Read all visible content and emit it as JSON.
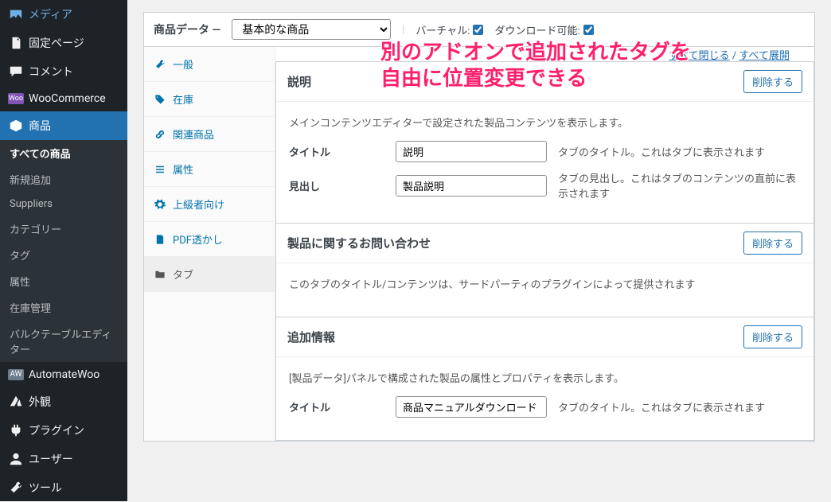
{
  "sidebar": {
    "items": [
      {
        "label": "メディア"
      },
      {
        "label": "固定ページ"
      },
      {
        "label": "コメント"
      },
      {
        "label": "WooCommerce"
      },
      {
        "label": "商品"
      },
      {
        "label": "AutomateWoo"
      },
      {
        "label": "外観"
      },
      {
        "label": "プラグイン"
      },
      {
        "label": "ユーザー"
      },
      {
        "label": "ツール"
      }
    ],
    "subitems": [
      {
        "label": "すべての商品"
      },
      {
        "label": "新規追加"
      },
      {
        "label": "Suppliers"
      },
      {
        "label": "カテゴリー"
      },
      {
        "label": "タグ"
      },
      {
        "label": "属性"
      },
      {
        "label": "在庫管理"
      },
      {
        "label": "バルクテーブルエディター"
      }
    ]
  },
  "header": {
    "label": "商品データ —",
    "select": "基本的な商品",
    "virtual_label": "バーチャル:",
    "download_label": "ダウンロード可能:"
  },
  "panel_tabs": [
    {
      "label": "一般"
    },
    {
      "label": "在庫"
    },
    {
      "label": "関連商品"
    },
    {
      "label": "属性"
    },
    {
      "label": "上級者向け"
    },
    {
      "label": "PDF透かし"
    },
    {
      "label": "タブ"
    }
  ],
  "links": {
    "collapse": "すべて閉じる",
    "expand": "すべて展開"
  },
  "blocks": {
    "desc": {
      "title": "説明",
      "remove": "削除する",
      "intro": "メインコンテンツエディターで設定された製品コンテンツを表示します。",
      "title_label": "タイトル",
      "title_value": "説明",
      "title_hint": "タブのタイトル。これはタブに表示されます",
      "heading_label": "見出し",
      "heading_value": "製品説明",
      "heading_hint": "タブの見出し。これはタブのコンテンツの直前に表示されます"
    },
    "inquiry": {
      "title": "製品に関するお問い合わせ",
      "remove": "削除する",
      "intro": "このタブのタイトル/コンテンツは、サードパーティのプラグインによって提供されます"
    },
    "additional": {
      "title": "追加情報",
      "remove": "削除する",
      "intro": "[製品データ]パネルで構成された製品の属性とプロパティを表示します。",
      "title_label": "タイトル",
      "title_value": "商品マニュアルダウンロード",
      "title_hint": "タブのタイトル。これはタブに表示されます"
    }
  },
  "overlay": {
    "line1": "別のアドオンで追加されたタグを",
    "line2": "自由に位置変更できる"
  }
}
